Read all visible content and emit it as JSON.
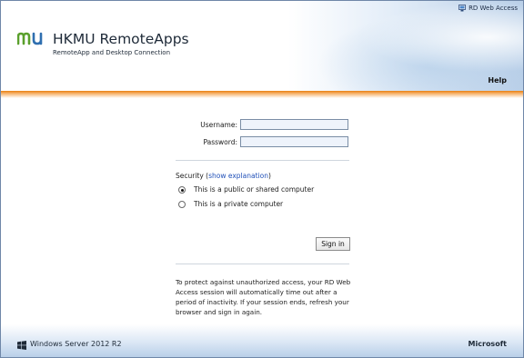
{
  "topbar": {
    "label": "RD Web Access",
    "icon": "rd-web-access-icon"
  },
  "header": {
    "logo_text": "mu",
    "title": "HKMU RemoteApps",
    "subtitle": "RemoteApp and Desktop Connection",
    "help_label": "Help"
  },
  "form": {
    "username_label": "Username:",
    "username_value": "",
    "password_label": "Password:",
    "password_value": "",
    "security_prefix": "Security (",
    "security_link": "show explanation",
    "security_suffix": ")",
    "options": [
      {
        "label": "This is a public or shared computer",
        "selected": true
      },
      {
        "label": "This is a private computer",
        "selected": false
      }
    ],
    "signin_label": "Sign in",
    "notice": "To protect against unauthorized access, your RD Web Access session will automatically time out after a period of inactivity. If your session ends, refresh your browser and sign in again."
  },
  "footer": {
    "windows_label": "Windows Server 2012 R2",
    "microsoft_label": "Microsoft"
  },
  "colors": {
    "accent_orange": "#e87f10",
    "link_blue": "#2050b8",
    "logo_green": "#5aa02c"
  }
}
